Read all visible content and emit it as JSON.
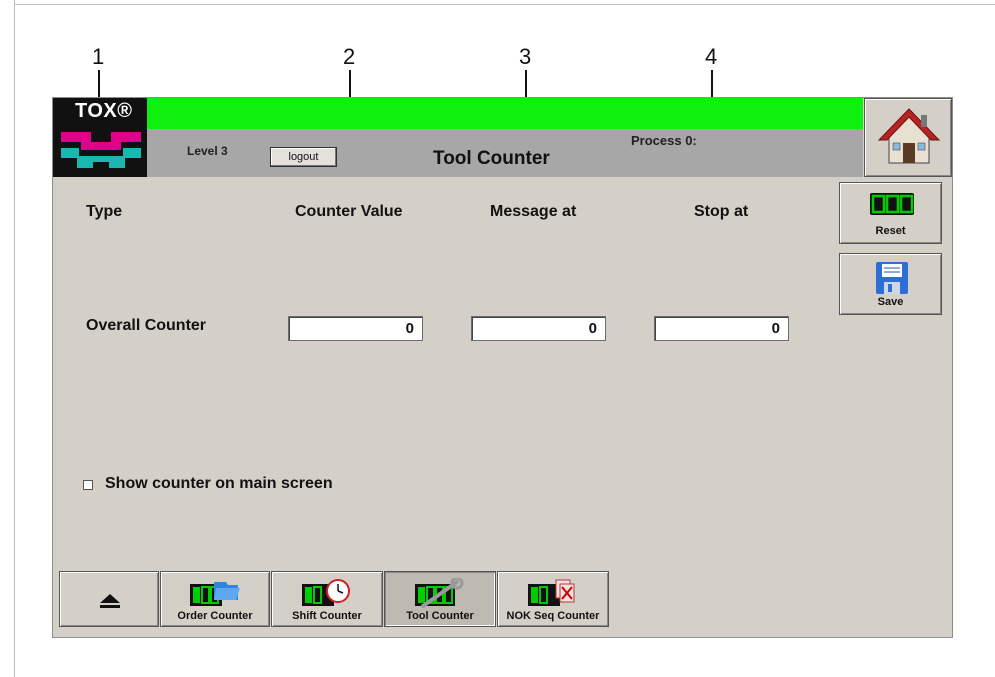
{
  "callouts": [
    "1",
    "2",
    "3",
    "4"
  ],
  "header": {
    "logo_text": "TOX®",
    "level": "Level 3",
    "logout_label": "logout",
    "process": "Process 0:",
    "title": "Tool Counter"
  },
  "columns": {
    "type": "Type",
    "counter_value": "Counter Value",
    "message_at": "Message at",
    "stop_at": "Stop at"
  },
  "rows": [
    {
      "label": "Overall Counter",
      "counter_value": "0",
      "message_at": "0",
      "stop_at": "0"
    }
  ],
  "side_buttons": {
    "reset_label": "Reset",
    "reset_display": "000",
    "save_label": "Save"
  },
  "show_counter": {
    "label": "Show counter on main screen",
    "checked": false
  },
  "tabs": [
    {
      "label": "",
      "icon": "eject-icon"
    },
    {
      "label": "Order Counter",
      "icon": "order-counter-icon"
    },
    {
      "label": "Shift Counter",
      "icon": "shift-counter-icon"
    },
    {
      "label": "Tool Counter",
      "icon": "tool-counter-icon",
      "active": true
    },
    {
      "label": "NOK Seq Counter",
      "icon": "nok-seq-counter-icon"
    }
  ],
  "colors": {
    "header_green": "#0ef00e",
    "header_gray": "#a7a7a7",
    "panel": "#d4d0c8",
    "counter_green": "#00cc00"
  }
}
